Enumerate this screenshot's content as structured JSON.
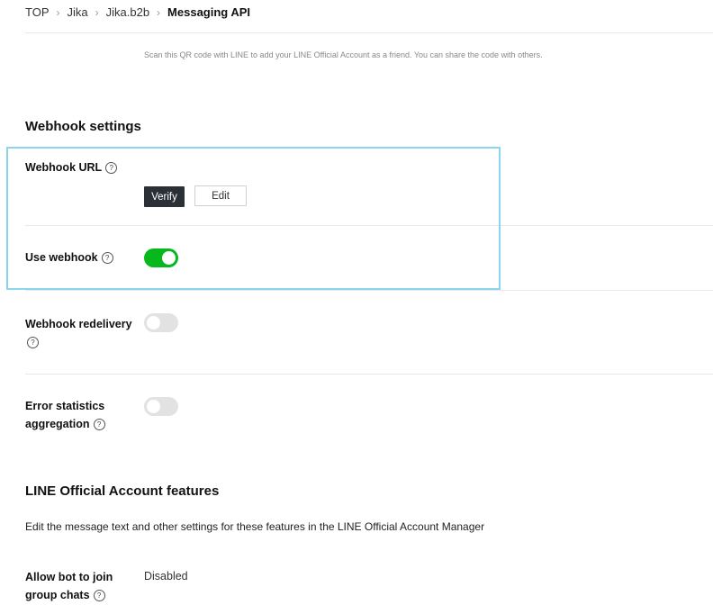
{
  "breadcrumb": {
    "items": [
      "TOP",
      "Jika",
      "Jika.b2b",
      "Messaging API"
    ],
    "separator": ">"
  },
  "qr_note": "Scan this QR code with LINE to add your LINE Official Account as a friend. You can share the code with others.",
  "webhook_settings": {
    "title": "Webhook settings",
    "help_glyph": "?",
    "webhook_url": {
      "label": "Webhook URL",
      "verify_label": "Verify",
      "edit_label": "Edit"
    },
    "use_webhook": {
      "label": "Use webhook",
      "enabled": true
    },
    "webhook_redelivery": {
      "label": "Webhook redelivery",
      "enabled": false
    },
    "error_statistics": {
      "label_line1": "Error statistics",
      "label_line2": "aggregation",
      "enabled": false
    }
  },
  "oa_features": {
    "title": "LINE Official Account features",
    "description": "Edit the message text and other settings for these features in the LINE Official Account Manager",
    "allow_bot": {
      "label_line1": "Allow bot to join",
      "label_line2": "group chats",
      "value": "Disabled"
    }
  },
  "colors": {
    "toggle_on": "#06b81c",
    "toggle_off": "#e2e2e2",
    "highlight_border": "#8dd4ee",
    "verify_bg": "#2b2f36"
  },
  "icons": [
    "chevron-right-icon",
    "help-circle-icon"
  ]
}
